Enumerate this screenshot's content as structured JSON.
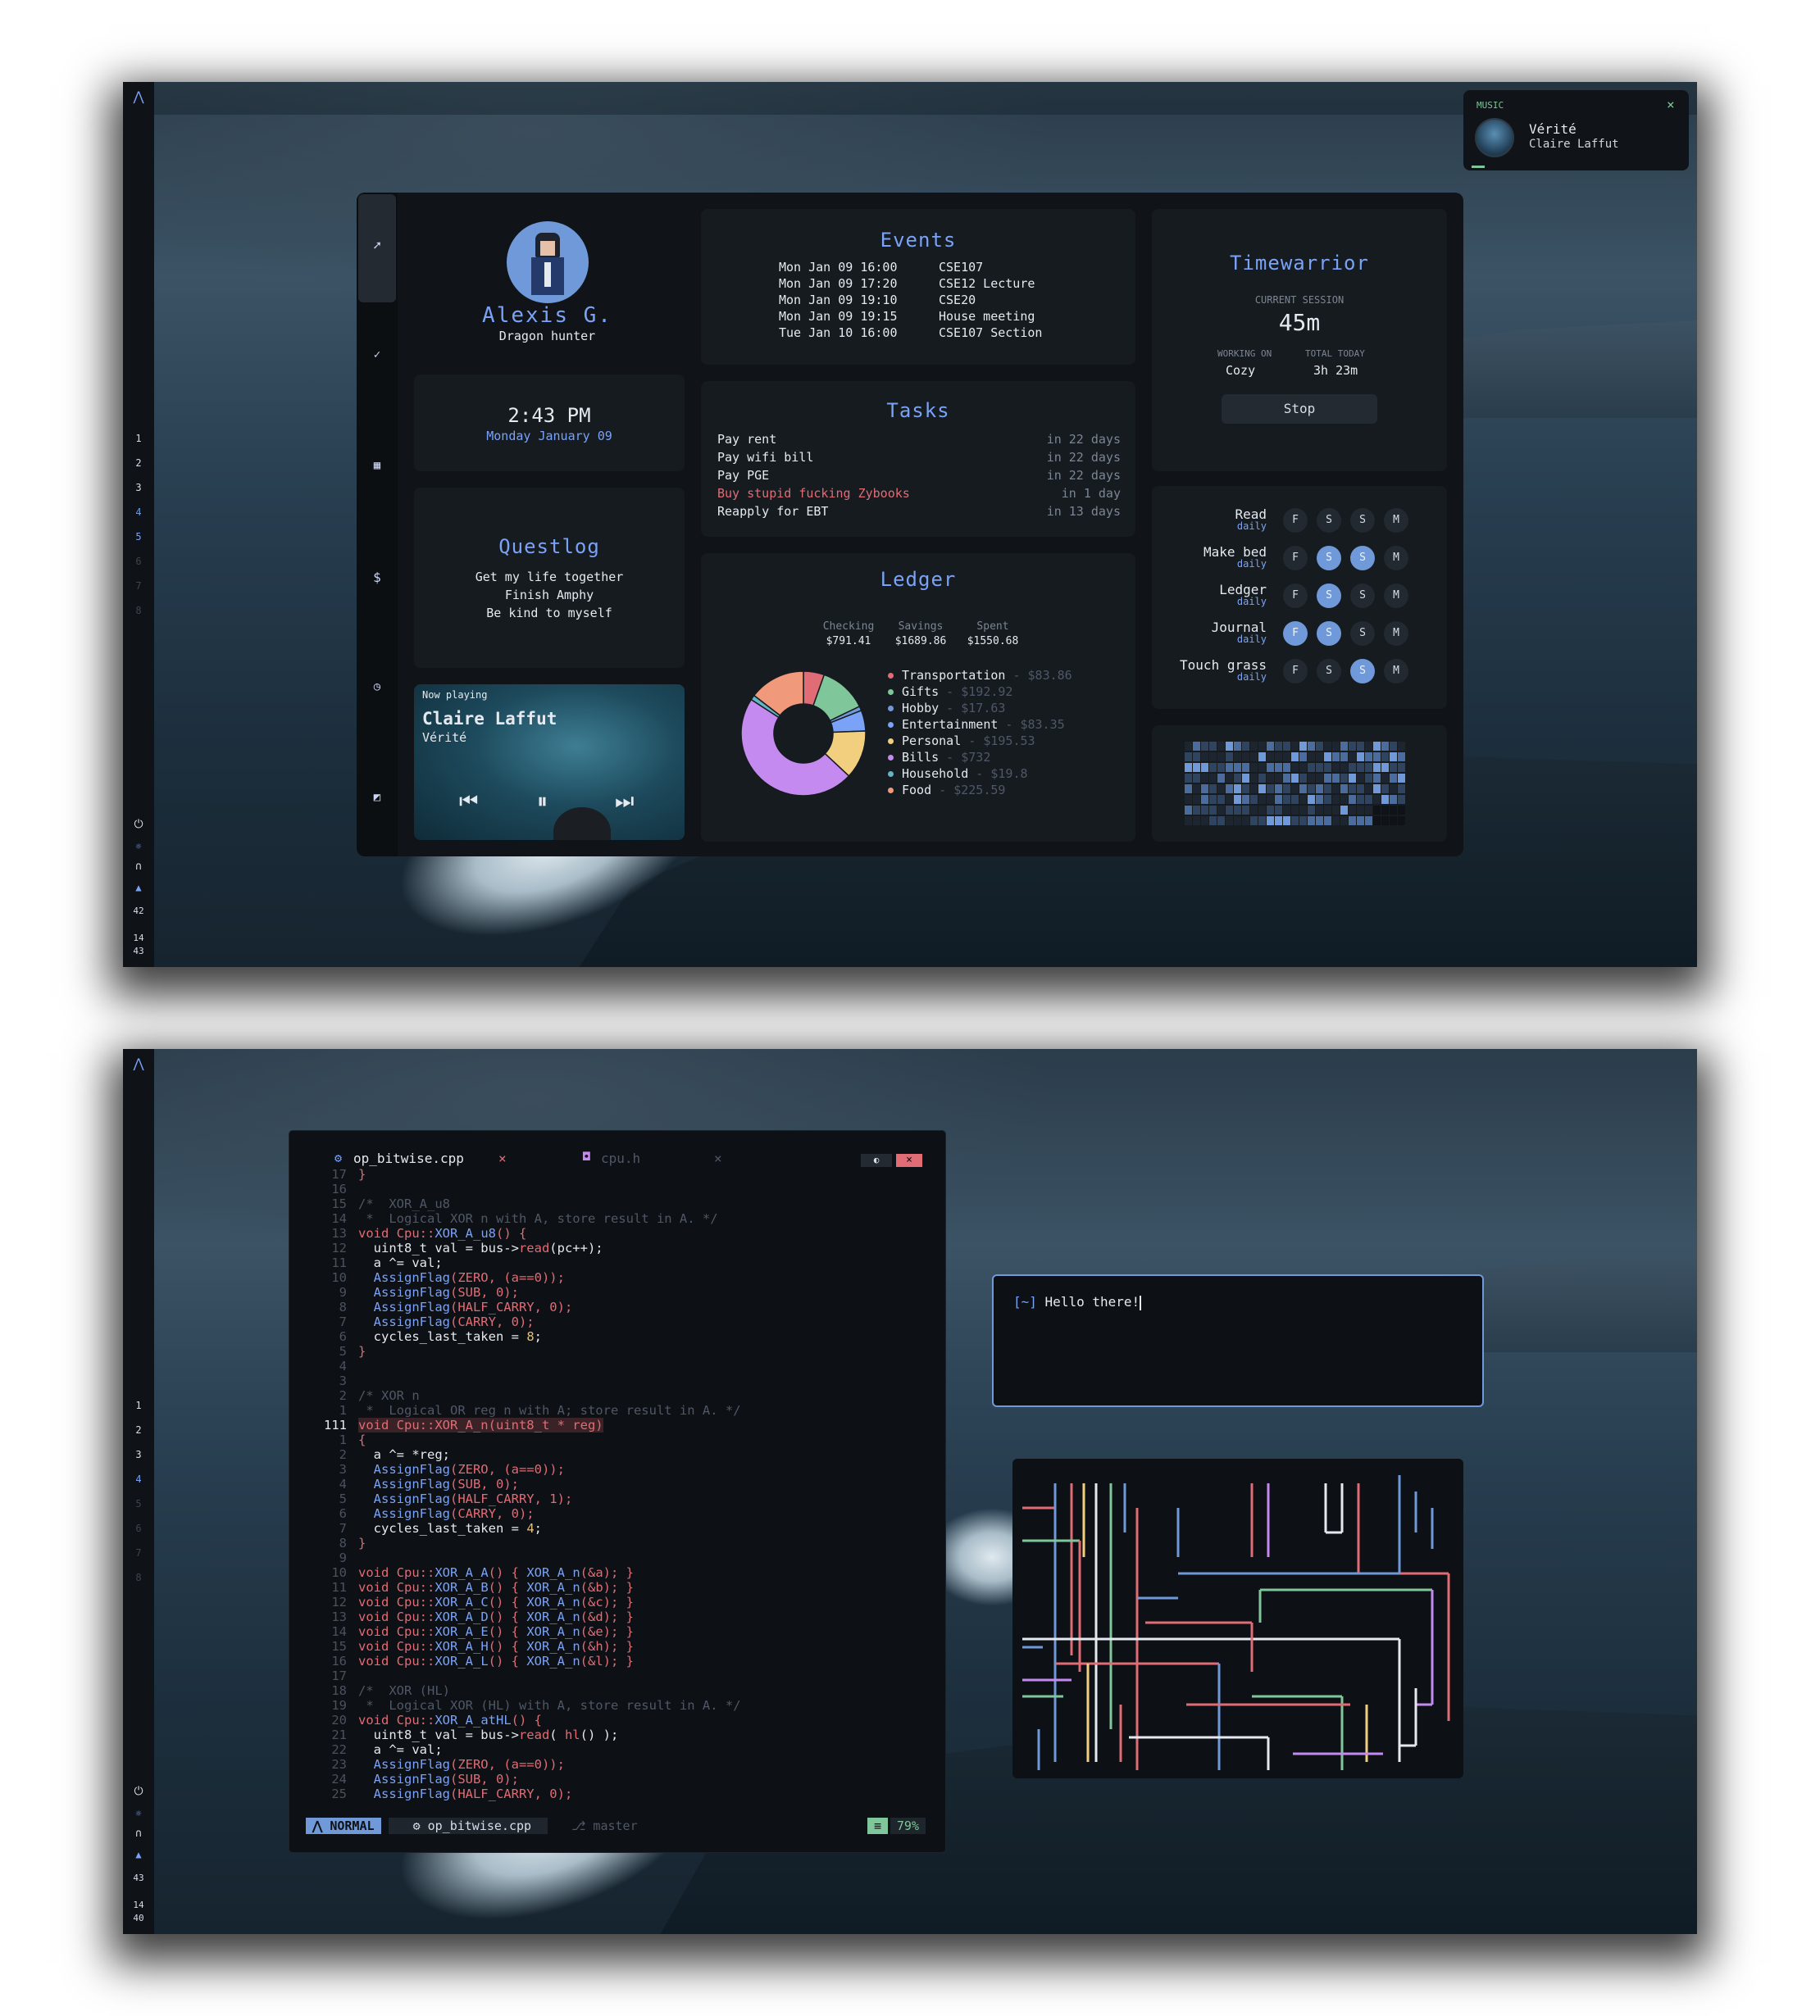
{
  "bar": {
    "logo": "⋀",
    "workspaces": [
      "1",
      "2",
      "3",
      "4",
      "5",
      "6",
      "7",
      "8"
    ],
    "active_workspace": "5",
    "bottom_icons": [
      "power-icon",
      "brightness-icon",
      "headphones-icon",
      "bell-icon"
    ],
    "shot1_numbers": [
      "42",
      "14",
      "43"
    ],
    "shot2_numbers": [
      "43",
      "14",
      "40"
    ]
  },
  "notification": {
    "label": "MUSIC",
    "close": "×",
    "title": "Vérité",
    "artist": "Claire Laffut"
  },
  "profile": {
    "name": "Alexis G.",
    "subtitle": "Dragon hunter"
  },
  "clock": {
    "time": "2:43 PM",
    "date": "Monday January 09"
  },
  "questlog": {
    "title": "Questlog",
    "items": [
      "Get my life together",
      "Finish Amphy",
      "Be kind to myself"
    ]
  },
  "now_playing": {
    "label": "Now playing",
    "artist": "Claire Laffut",
    "track": "Vérité"
  },
  "events": {
    "title": "Events",
    "rows": [
      {
        "when": "Mon Jan 09 16:00",
        "what": "CSE107"
      },
      {
        "when": "Mon Jan 09 17:20",
        "what": "CSE12 Lecture"
      },
      {
        "when": "Mon Jan 09 19:10",
        "what": "CSE20"
      },
      {
        "when": "Mon Jan 09 19:15",
        "what": "House meeting"
      },
      {
        "when": "Tue Jan 10 16:00",
        "what": "CSE107 Section"
      }
    ]
  },
  "tasks": {
    "title": "Tasks",
    "rows": [
      {
        "name": "Pay rent",
        "due": "in 22 days",
        "overdue": false
      },
      {
        "name": "Pay wifi bill",
        "due": "in 22 days",
        "overdue": false
      },
      {
        "name": "Pay PGE",
        "due": "in 22 days",
        "overdue": false
      },
      {
        "name": "Buy stupid fucking Zybooks",
        "due": "in 1 day",
        "overdue": true
      },
      {
        "name": "Reapply for EBT",
        "due": "in 13 days",
        "overdue": false
      }
    ]
  },
  "ledger": {
    "title": "Ledger",
    "accounts": [
      {
        "label": "Checking",
        "value": "$791.41"
      },
      {
        "label": "Savings",
        "value": "$1689.86"
      },
      {
        "label": "Spent",
        "value": "$1550.68"
      }
    ],
    "categories": [
      {
        "name": "Transportation",
        "amount": "$83.86",
        "value": 83.86,
        "color": "#e06c75"
      },
      {
        "name": "Gifts",
        "amount": "$192.92",
        "value": 192.92,
        "color": "#7fc69a"
      },
      {
        "name": "Hobby",
        "amount": "$17.63",
        "value": 17.63,
        "color": "#6f99d9"
      },
      {
        "name": "Entertainment",
        "amount": "$83.35",
        "value": 83.35,
        "color": "#7aa2f7"
      },
      {
        "name": "Personal",
        "amount": "$195.53",
        "value": 195.53,
        "color": "#f2cf7f"
      },
      {
        "name": "Bills",
        "amount": "$732",
        "value": 732,
        "color": "#c58af0"
      },
      {
        "name": "Household",
        "amount": "$19.8",
        "value": 19.8,
        "color": "#61b5c4"
      },
      {
        "name": "Food",
        "amount": "$225.59",
        "value": 225.59,
        "color": "#f0997b"
      }
    ]
  },
  "timewarrior": {
    "title": "Timewarrior",
    "current_label": "CURRENT SESSION",
    "current": "45m",
    "working_label": "WORKING ON",
    "working": "Cozy",
    "total_label": "TOTAL TODAY",
    "total": "3h 23m",
    "stop": "Stop"
  },
  "habits": {
    "days": [
      "F",
      "S",
      "S",
      "M"
    ],
    "rows": [
      {
        "name": "Read",
        "freq": "daily",
        "done": [
          false,
          false,
          false,
          false
        ]
      },
      {
        "name": "Make bed",
        "freq": "daily",
        "done": [
          false,
          true,
          true,
          false
        ]
      },
      {
        "name": "Ledger",
        "freq": "daily",
        "done": [
          false,
          true,
          false,
          false
        ]
      },
      {
        "name": "Journal",
        "freq": "daily",
        "done": [
          true,
          true,
          false,
          false
        ]
      },
      {
        "name": "Touch grass",
        "freq": "daily",
        "done": [
          false,
          false,
          true,
          false
        ]
      }
    ]
  },
  "editor": {
    "tab_active": "op_bitwise.cpp",
    "tab_inactive": "cpu.h",
    "tab_close": "×",
    "mode": "NORMAL",
    "file": "op_bitwise.cpp",
    "branch": "master",
    "percent": "79%"
  },
  "terminal": {
    "prompt": "[~]",
    "text": "Hello there!"
  },
  "colors": {
    "accent": "#7aa2f7",
    "red": "#e06c75",
    "green": "#7fc69a",
    "yellow": "#f2cf7f",
    "purple": "#c58af0",
    "bg": "#101418"
  }
}
